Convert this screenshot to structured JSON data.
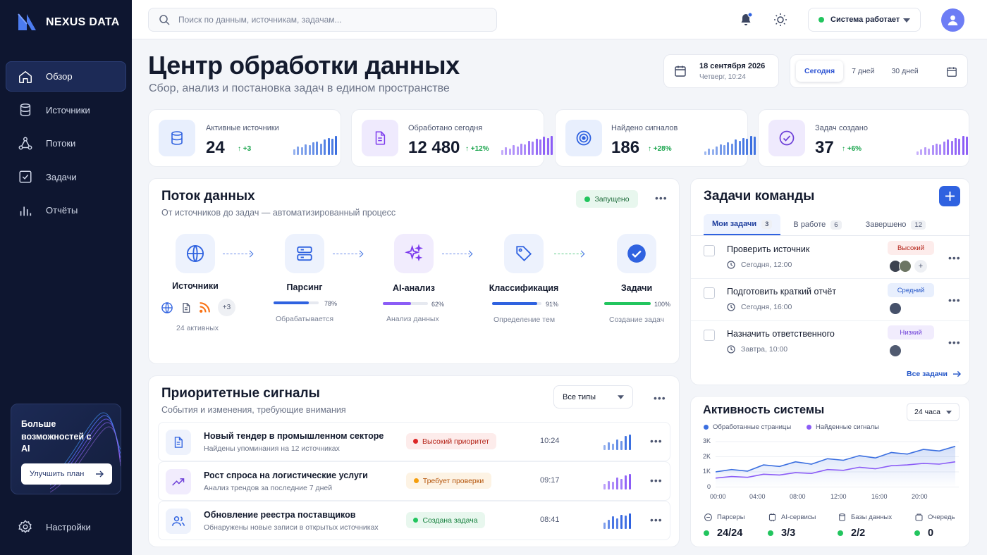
{
  "brand": {
    "name": "NEXUS DATA"
  },
  "nav": [
    {
      "label": "Обзор",
      "icon": "home-icon"
    },
    {
      "label": "Источники",
      "icon": "database-icon"
    },
    {
      "label": "Потоки",
      "icon": "flow-icon"
    },
    {
      "label": "Задачи",
      "icon": "checkbox-icon"
    },
    {
      "label": "Отчёты",
      "icon": "bar-chart-icon"
    }
  ],
  "promo": {
    "text": "Больше возможностей с AI",
    "button": "Улучшить план"
  },
  "settings_label": "Настройки",
  "topbar": {
    "search_placeholder": "Поиск по данным, источникам, задачам...",
    "status": "Система работает"
  },
  "header": {
    "title": "Центр обработки данных",
    "subtitle": "Сбор, анализ и постановка задач в едином пространстве",
    "date": "18 сентября 2026",
    "date_sub": "Четверг, 10:24",
    "ranges": [
      "Сегодня",
      "7 дней",
      "30 дней"
    ]
  },
  "stats": [
    {
      "label": "Активные источники",
      "value": "24",
      "delta": "+3",
      "icon": "database-icon",
      "bars": [
        0.3,
        0.45,
        0.4,
        0.55,
        0.5,
        0.65,
        0.7,
        0.6,
        0.8,
        0.9,
        0.85,
        1.0
      ]
    },
    {
      "label": "Обработано сегодня",
      "value": "12 480",
      "delta": "+12%",
      "icon": "document-icon",
      "bars": [
        0.25,
        0.4,
        0.35,
        0.5,
        0.45,
        0.6,
        0.55,
        0.75,
        0.7,
        0.85,
        0.8,
        0.95,
        0.9,
        1.0
      ]
    },
    {
      "label": "Найдено сигналов",
      "value": "186",
      "delta": "+28%",
      "icon": "target-icon",
      "bars": [
        0.2,
        0.35,
        0.3,
        0.45,
        0.55,
        0.5,
        0.65,
        0.6,
        0.8,
        0.75,
        0.9,
        0.85,
        1.0,
        0.95
      ]
    },
    {
      "label": "Задач создано",
      "value": "37",
      "delta": "+6%",
      "icon": "check-circle-icon",
      "bars": [
        0.2,
        0.3,
        0.4,
        0.35,
        0.5,
        0.6,
        0.55,
        0.7,
        0.8,
        0.75,
        0.9,
        0.85,
        1.0,
        0.95
      ]
    }
  ],
  "flow": {
    "title": "Поток данных",
    "subtitle": "От источников до задач — автоматизированный процесс",
    "status": "Запущено",
    "stages": [
      {
        "name": "Источники",
        "extra": "+3",
        "caption": "24 активных"
      },
      {
        "name": "Парсинг",
        "progress": 78,
        "pct": "78%",
        "caption": "Обрабатывается"
      },
      {
        "name": "AI-анализ",
        "progress": 62,
        "pct": "62%",
        "caption": "Анализ данных"
      },
      {
        "name": "Классификация",
        "progress": 91,
        "pct": "91%",
        "caption": "Определение тем"
      },
      {
        "name": "Задачи",
        "progress": 100,
        "pct": "100%",
        "caption": "Создание задач"
      }
    ]
  },
  "signals": {
    "title": "Приоритетные сигналы",
    "subtitle": "События и изменения, требующие внимания",
    "filter": "Все типы",
    "rows": [
      {
        "title": "Новый тендер в промышленном секторе",
        "sub": "Найдены упоминания на 12 источниках",
        "badge": "Высокий приоритет",
        "time": "10:24",
        "icon": "document-icon"
      },
      {
        "title": "Рост спроса на логистические услуги",
        "sub": "Анализ трендов за последние 7 дней",
        "badge": "Требует проверки",
        "time": "09:17",
        "icon": "trend-up-icon"
      },
      {
        "title": "Обновление реестра поставщиков",
        "sub": "Обнаружены новые записи в открытых источниках",
        "badge": "Создана задача",
        "time": "08:41",
        "icon": "users-icon"
      }
    ]
  },
  "tasks": {
    "title": "Задачи команды",
    "tabs": [
      {
        "label": "Мои задачи",
        "count": "3"
      },
      {
        "label": "В работе",
        "count": "6"
      },
      {
        "label": "Завершено",
        "count": "12"
      }
    ],
    "rows": [
      {
        "title": "Проверить источник",
        "time": "Сегодня, 12:00",
        "priority": "Высокий"
      },
      {
        "title": "Подготовить краткий отчёт",
        "time": "Сегодня, 16:00",
        "priority": "Средний"
      },
      {
        "title": "Назначить ответственного",
        "time": "Завтра, 10:00",
        "priority": "Низкий"
      }
    ],
    "all_link": "Все задачи"
  },
  "activity": {
    "title": "Активность системы",
    "period": "24 часа",
    "stats": [
      {
        "label": "Парсеры",
        "value": "24/24"
      },
      {
        "label": "AI-сервисы",
        "value": "3/3"
      },
      {
        "label": "Базы данных",
        "value": "2/2"
      },
      {
        "label": "Очередь",
        "value": "0"
      }
    ]
  },
  "chart_data": {
    "type": "line",
    "x": [
      "00:00",
      "04:00",
      "08:00",
      "12:00",
      "16:00",
      "20:00"
    ],
    "ylim": [
      0,
      3000
    ],
    "yticks": [
      "3K",
      "2K",
      "1K",
      "0"
    ],
    "series": [
      {
        "name": "Обработанные страницы",
        "color": "#3b6fe0",
        "values": [
          1000,
          1150,
          1050,
          1450,
          1350,
          1650,
          1500,
          1850,
          1750,
          2050,
          1900,
          2250,
          2150,
          2450,
          2350,
          2650
        ]
      },
      {
        "name": "Найденные сигналы",
        "color": "#8b5cf6",
        "values": [
          600,
          700,
          650,
          850,
          800,
          950,
          900,
          1150,
          1100,
          1300,
          1200,
          1400,
          1450,
          1550,
          1500,
          1650
        ]
      }
    ]
  }
}
